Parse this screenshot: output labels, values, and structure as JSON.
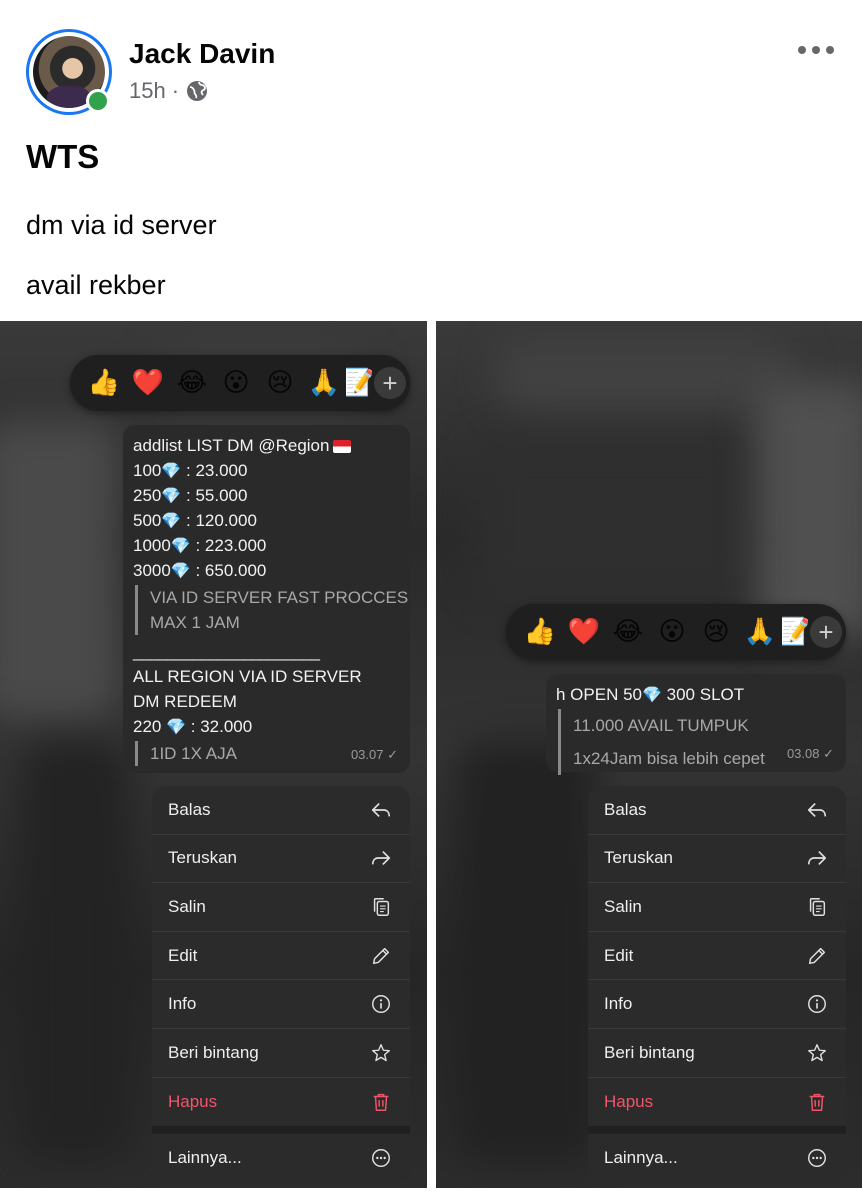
{
  "post": {
    "author": "Jack Davin",
    "time": "15h",
    "separator": "·",
    "title": "WTS",
    "lines": [
      "dm via id server",
      "avail rekber"
    ]
  },
  "colors": {
    "accent_blue": "#1877f2",
    "online_green": "#31a24c",
    "danger_red": "#f0566a",
    "gem_blue": "#3aa8e8"
  },
  "reactions": [
    "👍",
    "❤️",
    "😂",
    "😮",
    "😢",
    "🙏",
    "📝"
  ],
  "left_message": {
    "header": "addlist LIST DM @Region",
    "prices": [
      {
        "qty": "100",
        "price": " : 23.000"
      },
      {
        "qty": "250",
        "price": " : 55.000"
      },
      {
        "qty": "500",
        "price": " : 120.000"
      },
      {
        "qty": "1000",
        "price": " : 223.000"
      },
      {
        "qty": "3000",
        "price": " : 650.000"
      }
    ],
    "quote_lines": [
      "VIA ID SERVER FAST PROCCES",
      "MAX 1 JAM"
    ],
    "divider": "______________________",
    "region_line": "ALL REGION VIA ID SERVER",
    "redeem_line": "DM REDEEM",
    "redeem_qty": "220",
    "redeem_price": " : 32.000",
    "quote2": "1ID 1X AJA",
    "time": "03.07 ✓"
  },
  "right_message": {
    "header_prefix": "h OPEN 50",
    "header_suffix": " 300 SLOT",
    "quote_lines": [
      "11.000 AVAIL TUMPUK",
      "1x24Jam bisa lebih cepet"
    ],
    "time": "03.08 ✓"
  },
  "menu": {
    "reply": "Balas",
    "forward": "Teruskan",
    "copy": "Salin",
    "edit": "Edit",
    "info": "Info",
    "star": "Beri bintang",
    "delete": "Hapus",
    "more": "Lainnya..."
  },
  "icons": {
    "gem": "💎",
    "add": "+"
  }
}
